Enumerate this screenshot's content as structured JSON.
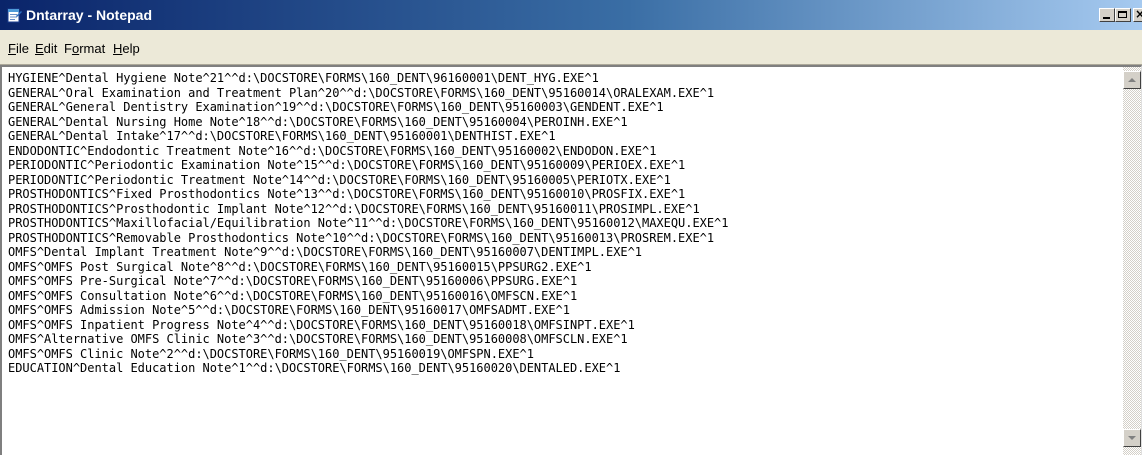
{
  "window": {
    "title": "Dntarray - Notepad",
    "icon": "notepad-icon",
    "controls": {
      "minimize": "minimize-icon",
      "maximize": "maximize-icon",
      "close": "close-icon"
    }
  },
  "menu": {
    "items": [
      {
        "mnemonic": "F",
        "rest": "ile"
      },
      {
        "mnemonic": "E",
        "rest": "dit"
      },
      {
        "pre": "F",
        "mnemonic": "o",
        "rest": "rmat"
      },
      {
        "mnemonic": "H",
        "rest": "elp"
      }
    ]
  },
  "editor": {
    "lines": [
      "HYGIENE^Dental Hygiene Note^21^^d:\\DOCSTORE\\FORMS\\160_DENT\\96160001\\DENT_HYG.EXE^1",
      "GENERAL^Oral Examination and Treatment Plan^20^^d:\\DOCSTORE\\FORMS\\160_DENT\\95160014\\ORALEXAM.EXE^1",
      "GENERAL^General Dentistry Examination^19^^d:\\DOCSTORE\\FORMS\\160_DENT\\95160003\\GENDENT.EXE^1",
      "GENERAL^Dental Nursing Home Note^18^^d:\\DOCSTORE\\FORMS\\160_DENT\\95160004\\PEROINH.EXE^1",
      "GENERAL^Dental Intake^17^^d:\\DOCSTORE\\FORMS\\160_DENT\\95160001\\DENTHIST.EXE^1",
      "ENDODONTIC^Endodontic Treatment Note^16^^d:\\DOCSTORE\\FORMS\\160_DENT\\95160002\\ENDODON.EXE^1",
      "PERIODONTIC^Periodontic Examination Note^15^^d:\\DOCSTORE\\FORMS\\160_DENT\\95160009\\PERIOEX.EXE^1",
      "PERIODONTIC^Periodontic Treatment Note^14^^d:\\DOCSTORE\\FORMS\\160_DENT\\95160005\\PERIOTX.EXE^1",
      "PROSTHODONTICS^Fixed Prosthodontics Note^13^^d:\\DOCSTORE\\FORMS\\160_DENT\\95160010\\PROSFIX.EXE^1",
      "PROSTHODONTICS^Prosthodontic Implant Note^12^^d:\\DOCSTORE\\FORMS\\160_DENT\\95160011\\PROSIMPL.EXE^1",
      "PROSTHODONTICS^Maxillofacial/Equilibration Note^11^^d:\\DOCSTORE\\FORMS\\160_DENT\\95160012\\MAXEQU.EXE^1",
      "PROSTHODONTICS^Removable Prosthodontics Note^10^^d:\\DOCSTORE\\FORMS\\160_DENT\\95160013\\PROSREM.EXE^1",
      "OMFS^Dental Implant Treatment Note^9^^d:\\DOCSTORE\\FORMS\\160_DENT\\95160007\\DENTIMPL.EXE^1",
      "OMFS^OMFS Post Surgical Note^8^^d:\\DOCSTORE\\FORMS\\160_DENT\\95160015\\PPSURG2.EXE^1",
      "OMFS^OMFS Pre-Surgical Note^7^^d:\\DOCSTORE\\FORMS\\160_DENT\\95160006\\PPSURG.EXE^1",
      "OMFS^OMFS Consultation Note^6^^d:\\DOCSTORE\\FORMS\\160_DENT\\95160016\\OMFSCN.EXE^1",
      "OMFS^OMFS Admission Note^5^^d:\\DOCSTORE\\FORMS\\160_DENT\\95160017\\OMFSADMT.EXE^1",
      "OMFS^OMFS Inpatient Progress Note^4^^d:\\DOCSTORE\\FORMS\\160_DENT\\95160018\\OMFSINPT.EXE^1",
      "OMFS^Alternative OMFS Clinic Note^3^^d:\\DOCSTORE\\FORMS\\160_DENT\\95160008\\OMFSCLN.EXE^1",
      "OMFS^OMFS Clinic Note^2^^d:\\DOCSTORE\\FORMS\\160_DENT\\95160019\\OMFSPN.EXE^1",
      "EDUCATION^Dental Education Note^1^^d:\\DOCSTORE\\FORMS\\160_DENT\\95160020\\DENTALED.EXE^1"
    ]
  },
  "scrollbar": {
    "up": "scroll-up-arrow-icon",
    "down": "scroll-down-arrow-icon"
  },
  "colors": {
    "titlebar_start": "#0a246a",
    "titlebar_end": "#a6caf0",
    "chrome": "#ece9d8",
    "editor_bg": "#ffffff"
  }
}
